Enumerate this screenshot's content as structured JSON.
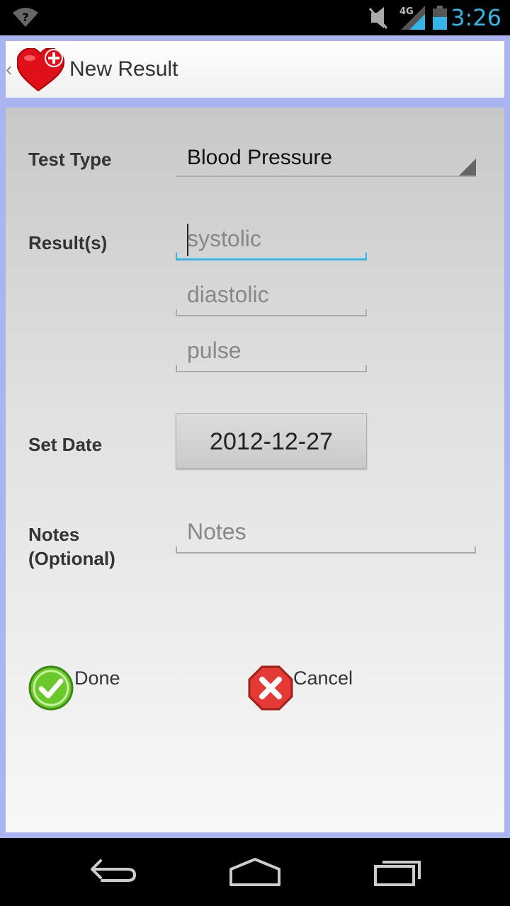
{
  "status_bar": {
    "network": "4G",
    "time": "3:26",
    "icons": [
      "wifi-unknown-icon",
      "mute-icon",
      "signal-icon",
      "battery-icon"
    ]
  },
  "action_bar": {
    "title": "New Result",
    "logo": "heart-plus-icon"
  },
  "form": {
    "test_type": {
      "label": "Test Type",
      "value": "Blood Pressure"
    },
    "results": {
      "label": "Result(s)",
      "fields": [
        {
          "placeholder": "systolic"
        },
        {
          "placeholder": "diastolic"
        },
        {
          "placeholder": "pulse"
        }
      ]
    },
    "set_date": {
      "label": "Set Date",
      "value": "2012-12-27"
    },
    "notes": {
      "label_line1": "Notes",
      "label_line2": "(Optional)",
      "placeholder": "Notes"
    },
    "done_label": "Done",
    "cancel_label": "Cancel"
  },
  "nav_bar": {
    "icons": [
      "back-icon",
      "home-icon",
      "recents-icon"
    ]
  },
  "colors": {
    "accent": "#33b5e5",
    "done_green": "#6ac82a",
    "cancel_red": "#e53935",
    "heart_red": "#e0101a"
  }
}
